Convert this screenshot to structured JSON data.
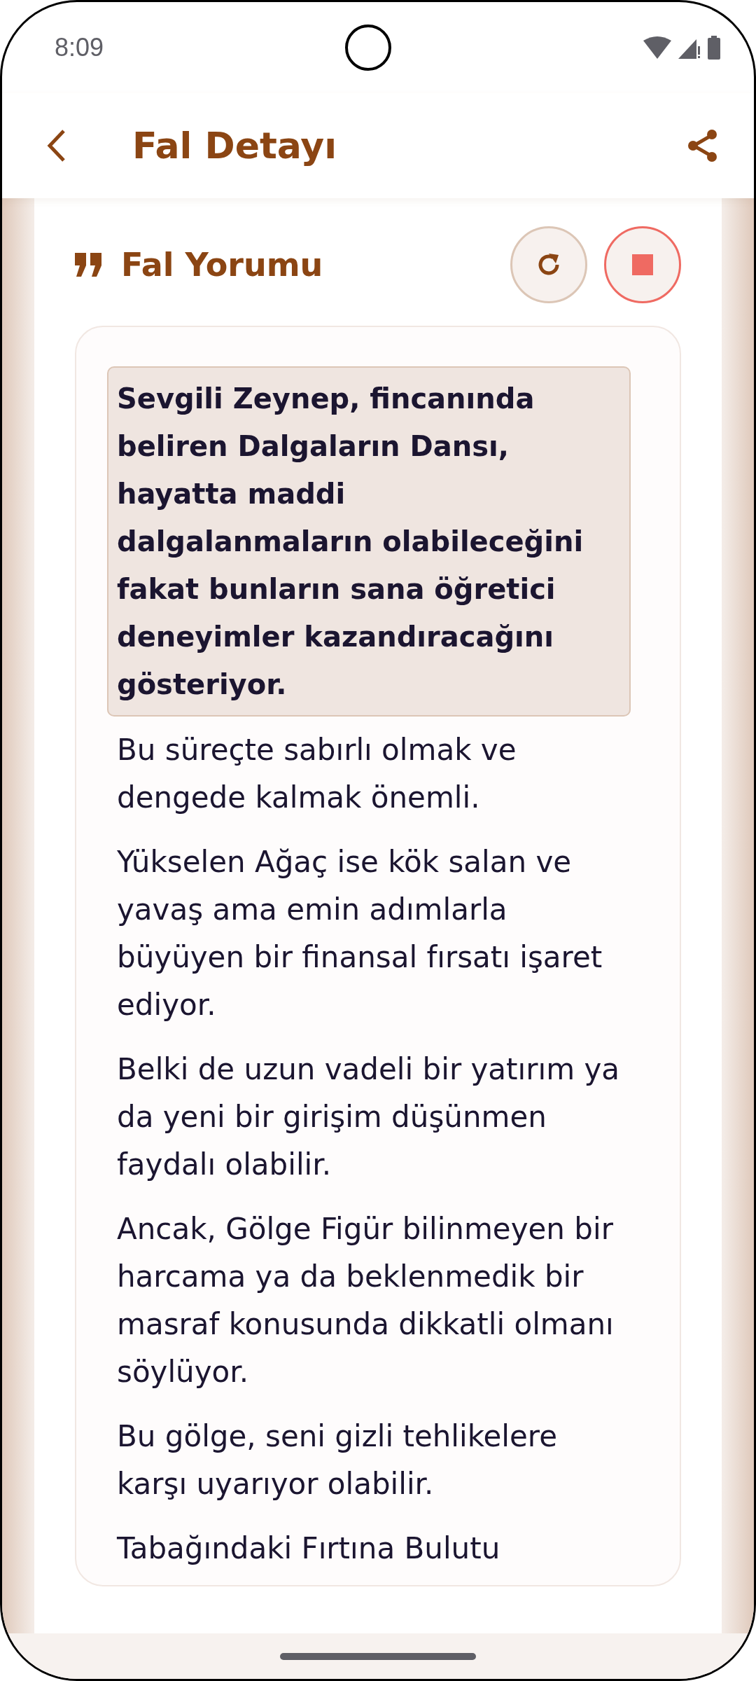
{
  "status_bar": {
    "time": "8:09"
  },
  "app_bar": {
    "title": "Fal Detayı"
  },
  "section": {
    "title": "Fal Yorumu"
  },
  "highlight": "Sevgili Zeynep, fincanında beliren Dalgaların Dansı, hayatta maddi dalgalanmaların olabileceğini fakat bunların sana öğretici deneyimler kazandıracağını gösteriyor.",
  "paragraphs": [
    "Bu süreçte sabırlı olmak ve dengede kalmak önemli.",
    "Yükselen Ağaç ise kök salan ve yavaş ama emin adımlarla büyüyen bir finansal fırsatı işaret ediyor.",
    "Belki de uzun vadeli bir yatırım ya da yeni bir girişim düşünmen faydalı olabilir.",
    "Ancak, Gölge Figür bilinmeyen bir harcama ya da beklenmedik bir masraf konusunda dikkatli olmanı söylüyor.",
    "Bu gölge, seni gizli tehlikelere karşı uyarıyor olabilir.",
    "Tabağındaki Fırtına Bulutu"
  ]
}
